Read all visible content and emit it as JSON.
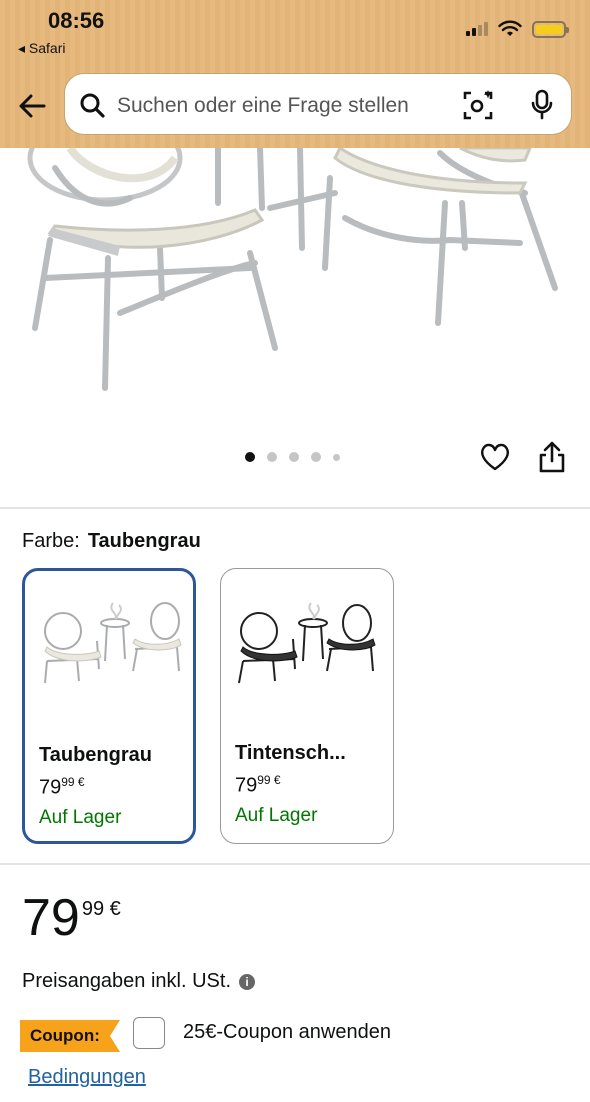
{
  "status_bar": {
    "time": "08:56",
    "back_app": "◂ Safari"
  },
  "search": {
    "placeholder": "Suchen oder eine Frage stellen"
  },
  "gallery": {
    "image_count": 5,
    "active_index": 0
  },
  "color": {
    "label": "Farbe:",
    "selected": "Taubengrau",
    "options": [
      {
        "name": "Taubengrau",
        "price_main": "79",
        "price_frac": "99 €",
        "stock": "Auf Lager",
        "selected": true
      },
      {
        "name": "Tintensch...",
        "price_main": "79",
        "price_frac": "99 €",
        "stock": "Auf Lager",
        "selected": false
      }
    ]
  },
  "price": {
    "main": "79",
    "fraction": "99 €"
  },
  "tax_note": "Preisangaben inkl. USt.",
  "coupon": {
    "badge": "Coupon:",
    "label": "25€-Coupon anwenden",
    "checked": false
  },
  "conditions_link": "Bedingungen",
  "colors": {
    "header": "#e6b97f",
    "selected_border": "#2d5897",
    "stock": "#007600",
    "link": "#2162a1",
    "coupon": "#f7a21b"
  }
}
